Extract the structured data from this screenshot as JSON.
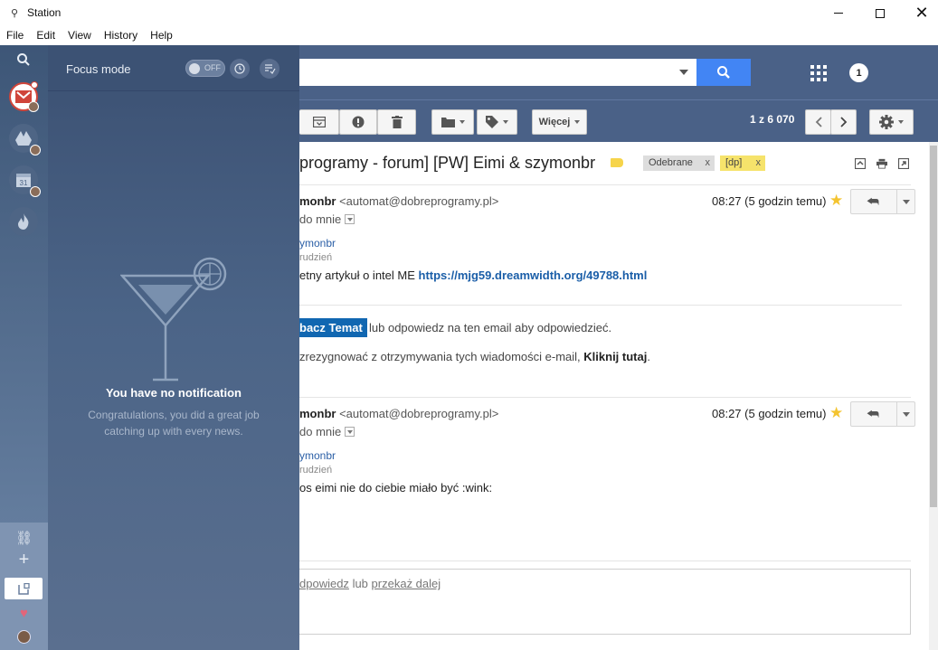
{
  "window": {
    "title": "Station"
  },
  "menu": [
    "File",
    "Edit",
    "View",
    "History",
    "Help"
  ],
  "dock": {
    "apps": [
      {
        "name": "gmail",
        "icon": "gmail-icon"
      },
      {
        "name": "drive",
        "icon": "drive-icon"
      },
      {
        "name": "calendar",
        "icon": "calendar-icon",
        "day": "31"
      },
      {
        "name": "hot",
        "icon": "flame-icon"
      }
    ]
  },
  "panel": {
    "header_label": "Focus mode",
    "toggle_state": "OFF",
    "empty_title": "You have no notification",
    "empty_subtitle": "Congratulations, you did a great job catching up with every news."
  },
  "gmail": {
    "notification_count": "1",
    "toolbar": {
      "more_label": "Więcej",
      "pager": "1 z 6 070"
    },
    "subject": "programy - forum] [PW] Eimi & szymonbr",
    "labels": [
      {
        "text": "Odebrane",
        "close": "x"
      },
      {
        "text": "[dp]",
        "close": "x"
      }
    ],
    "messages": [
      {
        "sender_name": "monbr",
        "sender_addr": "<automat@dobreprogramy.pl>",
        "to": "do mnie",
        "time": "08:27 (5 godzin temu)",
        "body_name": "ymonbr",
        "body_date": "rudzień",
        "body_text": "etny artykuł o intel ME ",
        "body_link": "https://mjg59.dreamwidth.org/49788.html",
        "cta_button": "bacz Temat",
        "cta_after": "lub odpowiedz na ten email aby odpowiedzieć.",
        "unsub_text": "zrezygnować z otrzymywania tych wiadomości e-mail, ",
        "unsub_link": "Kliknij tutaj",
        "unsub_end": "."
      },
      {
        "sender_name": "monbr",
        "sender_addr": "<automat@dobreprogramy.pl>",
        "to": "do mnie",
        "time": "08:27 (5 godzin temu)",
        "body_name": "ymonbr",
        "body_date": "rudzień",
        "body_text": "os eimi nie do ciebie miało być :wink:"
      }
    ],
    "reply": {
      "reply_link": "dpowiedz",
      "or": "lub",
      "forward_link": "przekaż dalej"
    }
  }
}
